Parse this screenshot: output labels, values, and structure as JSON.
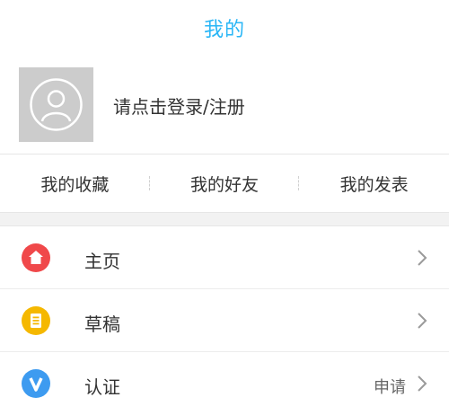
{
  "header": {
    "title": "我的"
  },
  "profile": {
    "login_prompt": "请点击登录/注册",
    "avatar_icon": "user-avatar-icon"
  },
  "quick_links": [
    {
      "label": "我的收藏"
    },
    {
      "label": "我的好友"
    },
    {
      "label": "我的发表"
    }
  ],
  "menu": [
    {
      "label": "主页",
      "value": "",
      "icon": "home-icon",
      "icon_color": "#f0484a"
    },
    {
      "label": "草稿",
      "value": "",
      "icon": "draft-icon",
      "icon_color": "#f5b800"
    },
    {
      "label": "认证",
      "value": "申请",
      "icon": "verify-icon",
      "icon_color": "#3d9bf0"
    }
  ],
  "colors": {
    "accent": "#29b6f6",
    "text": "#333333",
    "avatar_bg": "#cccccc"
  }
}
